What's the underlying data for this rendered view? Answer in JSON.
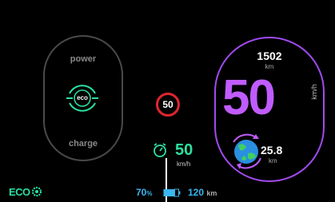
{
  "left_panel": {
    "power_label": "power",
    "charge_label": "charge",
    "mode_icon_text": "eco"
  },
  "center": {
    "speed_limit": "50",
    "cruise_speed": "50",
    "cruise_unit": "km/h"
  },
  "right_panel": {
    "odometer": "1502",
    "odometer_unit": "km",
    "speed": "50",
    "speed_unit": "km/h",
    "eco_distance": "25.8",
    "eco_distance_unit": "km"
  },
  "bottom": {
    "mode_label": "ECO",
    "battery_percent": "70",
    "battery_percent_unit": "%",
    "range": "120",
    "range_unit": "km"
  },
  "colors": {
    "accent_green": "#2de0a0",
    "accent_purple": "#c05cff",
    "accent_cyan": "#3ab6f0",
    "limit_red": "#e0262e"
  }
}
